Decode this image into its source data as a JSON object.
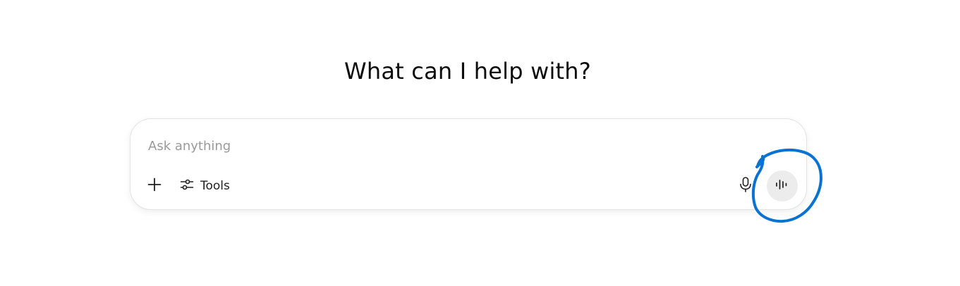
{
  "main": {
    "heading": "What can I help with?"
  },
  "composer": {
    "placeholder": "Ask anything",
    "value": "",
    "tools_label": "Tools"
  },
  "icons": {
    "attach": "plus-icon",
    "tools": "sliders-icon",
    "dictate": "microphone-icon",
    "voice_mode": "waveform-icon"
  },
  "annotation": {
    "color": "#0a72d1",
    "target": "voice-mode-button"
  }
}
